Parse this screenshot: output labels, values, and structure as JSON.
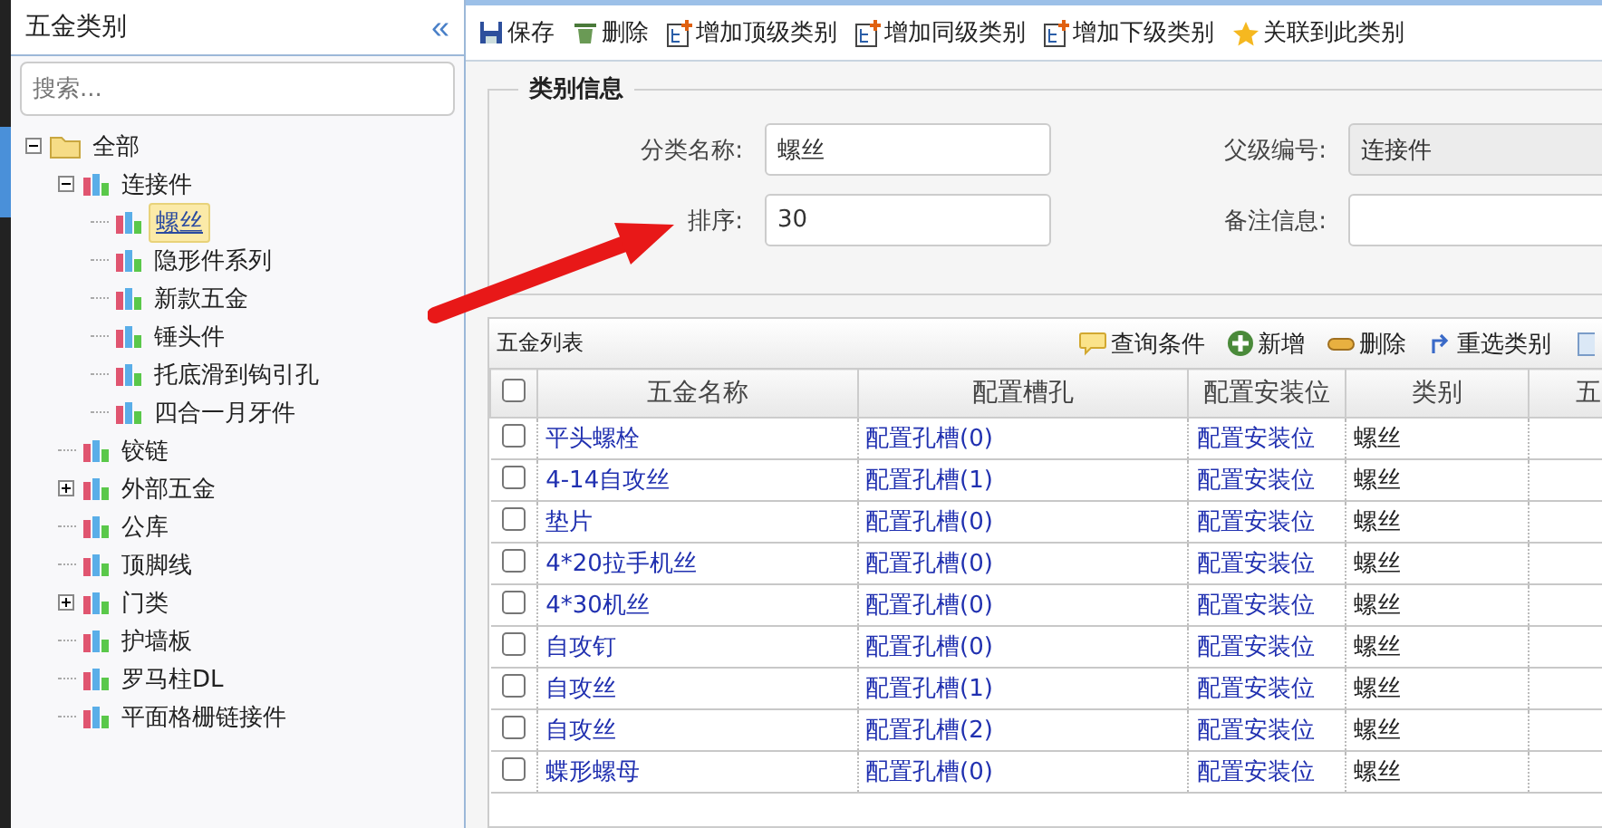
{
  "sidebar": {
    "title": "五金类别",
    "collapse": "«",
    "search": {
      "placeholder": "搜索..."
    }
  },
  "tree": [
    {
      "label": "全部",
      "kind": "folder",
      "expanded": true,
      "selected": false,
      "children": [
        {
          "label": "连接件",
          "kind": "category",
          "expanded": true,
          "selected": false,
          "children": [
            {
              "label": "螺丝",
              "kind": "category",
              "selected": true
            },
            {
              "label": "隐形件系列",
              "kind": "category",
              "selected": false
            },
            {
              "label": "新款五金",
              "kind": "category",
              "selected": false
            },
            {
              "label": "锤头件",
              "kind": "category",
              "selected": false
            },
            {
              "label": "托底滑到钩引孔",
              "kind": "category",
              "selected": false
            },
            {
              "label": "四合一月牙件",
              "kind": "category",
              "selected": false
            }
          ]
        },
        {
          "label": "铰链",
          "kind": "category",
          "selected": false
        },
        {
          "label": "外部五金",
          "kind": "category",
          "expanded": false,
          "selected": false
        },
        {
          "label": "公库",
          "kind": "category",
          "selected": false
        },
        {
          "label": "顶脚线",
          "kind": "category",
          "selected": false
        },
        {
          "label": "门类",
          "kind": "category",
          "expanded": false,
          "selected": false
        },
        {
          "label": "护墙板",
          "kind": "category",
          "selected": false
        },
        {
          "label": "罗马柱DL",
          "kind": "category",
          "selected": false
        },
        {
          "label": "平面格栅链接件",
          "kind": "category",
          "selected": false
        }
      ]
    }
  ],
  "toolbar": [
    {
      "label": "保存",
      "kind": "save"
    },
    {
      "label": "删除",
      "kind": "trash"
    },
    {
      "label": "增加顶级类别",
      "kind": "add"
    },
    {
      "label": "增加同级类别",
      "kind": "add"
    },
    {
      "label": "增加下级类别",
      "kind": "add"
    },
    {
      "label": "关联到此类别",
      "kind": "star"
    }
  ],
  "form": {
    "legend": "类别信息",
    "fields": [
      {
        "label": "分类名称:",
        "value": "螺丝",
        "disabled": false
      },
      {
        "label": "父级编号:",
        "value": "连接件",
        "disabled": true
      },
      {
        "label": "排序:",
        "value": "30",
        "disabled": false
      },
      {
        "label": "备注信息:",
        "disabled": false
      }
    ]
  },
  "grid": {
    "title": "五金列表",
    "tools": [
      {
        "label": "查询条件",
        "kind": "query"
      },
      {
        "label": "新增",
        "kind": "plus"
      },
      {
        "label": "删除",
        "kind": "minus"
      },
      {
        "label": "重选类别",
        "kind": "reselect"
      }
    ],
    "header_checked": false,
    "columns": [
      "五金名称",
      "配置槽孔",
      "配置安装位",
      "类别",
      "五"
    ],
    "rows": [
      {
        "checked": false,
        "name": "平头螺栓",
        "slots": "配置孔槽(0)",
        "position": "配置安装位",
        "category": "螺丝"
      },
      {
        "checked": false,
        "name": "4-14自攻丝",
        "slots": "配置孔槽(1)",
        "position": "配置安装位",
        "category": "螺丝"
      },
      {
        "checked": false,
        "name": "垫片",
        "slots": "配置孔槽(0)",
        "position": "配置安装位",
        "category": "螺丝"
      },
      {
        "checked": false,
        "name": "4*20拉手机丝",
        "slots": "配置孔槽(0)",
        "position": "配置安装位",
        "category": "螺丝"
      },
      {
        "checked": false,
        "name": "4*30机丝",
        "slots": "配置孔槽(0)",
        "position": "配置安装位",
        "category": "螺丝"
      },
      {
        "checked": false,
        "name": "自攻钉",
        "slots": "配置孔槽(0)",
        "position": "配置安装位",
        "category": "螺丝"
      },
      {
        "checked": false,
        "name": "自攻丝",
        "slots": "配置孔槽(1)",
        "position": "配置安装位",
        "category": "螺丝"
      },
      {
        "checked": false,
        "name": "自攻丝",
        "slots": "配置孔槽(2)",
        "position": "配置安装位",
        "category": "螺丝"
      },
      {
        "checked": false,
        "name": "蝶形螺母",
        "slots": "配置孔槽(0)",
        "position": "配置安装位",
        "category": "螺丝"
      }
    ]
  }
}
